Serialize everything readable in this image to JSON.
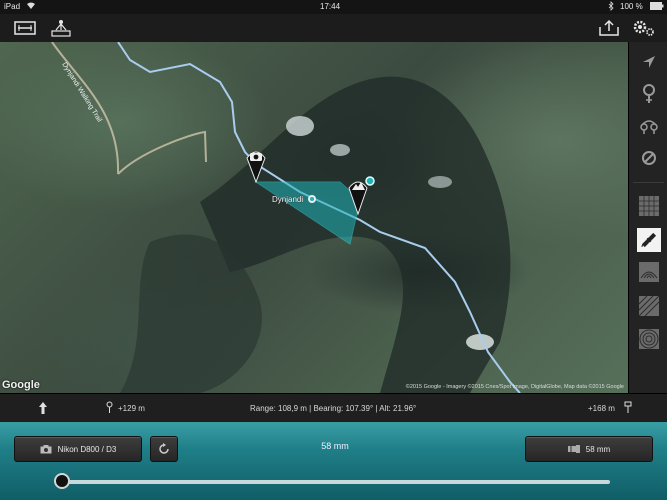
{
  "status_bar": {
    "device": "iPad",
    "time": "17:44",
    "battery": "100 %"
  },
  "toolbar": {
    "left_icons": [
      "ruler-card-icon",
      "surveyor-icon"
    ],
    "right_icons": [
      "share-upload-icon",
      "settings-gears-icon"
    ]
  },
  "map": {
    "trail_label": "Dynjandi Walking Trail",
    "place_label": "Dynjandi",
    "google_logo": "Google",
    "attribution": "©2015 Google - Imagery ©2015 Cnes/Spot Image, DigitalGlobe, Map data ©2015 Google",
    "markers": [
      "camera-marker-icon",
      "mountain-target-marker-icon"
    ]
  },
  "sidebar": {
    "icons": [
      "location-arrow-icon",
      "pin-add-icon",
      "pins-pair-icon",
      "no-entry-icon",
      "map-grid-icon",
      "satellite-icon",
      "terrain-icon",
      "hybrid-icon",
      "topo-icon"
    ],
    "selected_index": 5
  },
  "info_bar": {
    "left_elevation": "+129 m",
    "center": "Range: 108,9 m | Bearing: 107.39° | Alt: 21.96°",
    "right_elevation": "+168 m"
  },
  "bottom_panel": {
    "camera_label": "Nikon D800 / D3",
    "focal_center": "58 mm",
    "lens_label": "58 mm",
    "slider_value": 0.0
  },
  "colors": {
    "accent": "#2a8f98",
    "route": "#9fc4e8",
    "view_cone": "#1fb3b8"
  }
}
